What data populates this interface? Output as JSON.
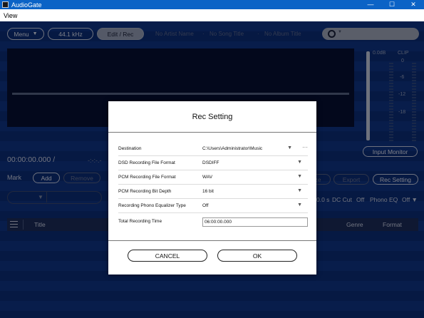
{
  "window": {
    "title": "AudioGate",
    "minimize": "—",
    "maximize": "☐",
    "close": "✕"
  },
  "menu": {
    "view": "View"
  },
  "toolbar": {
    "menu_label": "Menu",
    "sample_rate": "44.1 kHz",
    "mode_tab": "Edit / Rec",
    "artist_placeholder": "No Artist Name",
    "song_placeholder": "No Song Title",
    "album_placeholder": "No Album Title"
  },
  "meter": {
    "top_label": "0.0dB",
    "clip_label": "CLIP",
    "ticks": [
      "0",
      "-6",
      "-12",
      "-18"
    ]
  },
  "transport": {
    "time": "00:00:00.000 /",
    "dashes": "-:-:-.-"
  },
  "marks": {
    "label": "Mark",
    "add": "Add",
    "remove": "Remove"
  },
  "right_panel": {
    "input_monitor": "Input Monitor",
    "normalize_fragment": "ze",
    "export": "Export",
    "rec_setting": "Rec Setting",
    "time_fragment": "0.0 s",
    "dc_cut": "DC Cut",
    "dc_cut_state": "Off",
    "phono_eq": "Phono EQ",
    "phono_eq_state": "Off ▼"
  },
  "list": {
    "title_col": "Title",
    "genre_col": "Genre",
    "format_col": "Format"
  },
  "dialog": {
    "title": "Rec Setting",
    "rows": [
      {
        "label": "Destination",
        "value": "C:\\Users\\Administrator\\Music"
      },
      {
        "label": "DSD Recording File Format",
        "value": "DSDIFF"
      },
      {
        "label": "PCM Recording File Format",
        "value": "WAV"
      },
      {
        "label": "PCM Recording Bit Depth",
        "value": "16 bit"
      },
      {
        "label": "Recording Phono Equalizer Type",
        "value": "Off"
      },
      {
        "label": "Total Recording Time",
        "value": "06:00:00.000"
      }
    ],
    "cancel": "CANCEL",
    "ok": "OK"
  },
  "colors": {
    "titlebar": "#0b63c6",
    "app_bg": "#0f3580",
    "dialog_bg": "#ffffff"
  }
}
